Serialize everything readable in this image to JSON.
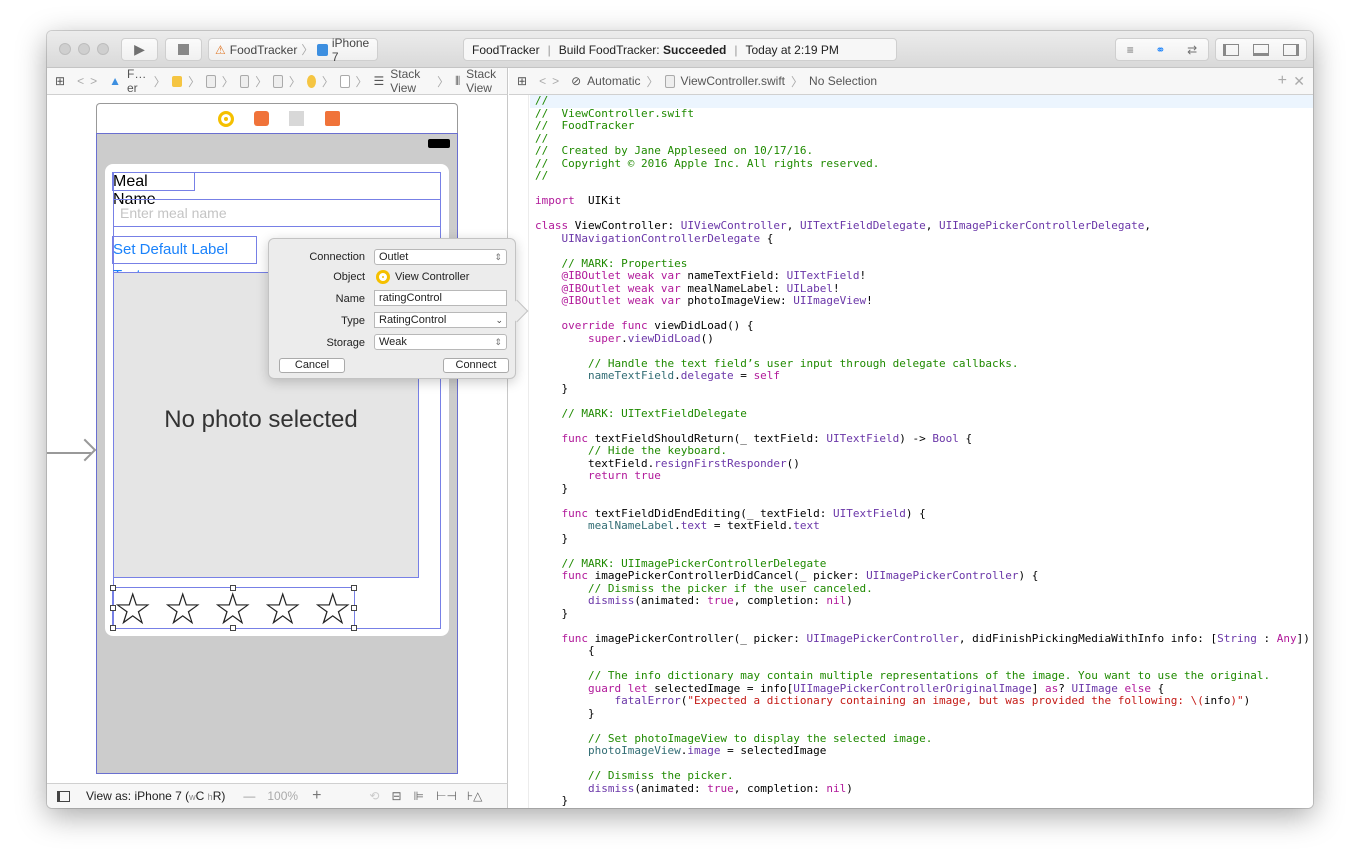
{
  "toolbar": {
    "scheme": "FoodTracker",
    "device": "iPhone 7",
    "activity": {
      "project": "FoodTracker",
      "build_prefix": "Build FoodTracker:",
      "build_status": "Succeeded",
      "time": "Today at 2:19 PM"
    }
  },
  "left_jumpbar": {
    "items": [
      "F…er",
      "Stack View",
      "Stack View"
    ]
  },
  "right_jumpbar": {
    "mode": "Automatic",
    "file": "ViewController.swift",
    "selection": "No Selection"
  },
  "canvas": {
    "meal_name_label": "Meal Name",
    "meal_name_placeholder": "Enter meal name",
    "set_default_button": "Set Default Label Text",
    "photo_placeholder": "No photo selected",
    "star_count": 5
  },
  "popover": {
    "connection_label": "Connection",
    "connection_value": "Outlet",
    "object_label": "Object",
    "object_value": "View Controller",
    "name_label": "Name",
    "name_value": "ratingControl",
    "type_label": "Type",
    "type_value": "RatingControl",
    "storage_label": "Storage",
    "storage_value": "Weak",
    "cancel": "Cancel",
    "connect": "Connect"
  },
  "bottom_bar": {
    "view_as": "View as: iPhone 7 (",
    "w": "w",
    "wc": "C ",
    "h": "h",
    "hr": "R)",
    "zoom": "100%"
  },
  "colors": {
    "selection": "#7780e6",
    "accent": "#1a82fb",
    "comment": "#1f8a00",
    "keyword": "#b1199a",
    "type": "#6a36a8",
    "project": "#326d74",
    "string": "#c41a16"
  },
  "code": [
    [
      [
        "c",
        "//"
      ]
    ],
    [
      [
        "c",
        "//  ViewController.swift"
      ]
    ],
    [
      [
        "c",
        "//  FoodTracker"
      ]
    ],
    [
      [
        "c",
        "//"
      ]
    ],
    [
      [
        "c",
        "//  Created by Jane Appleseed on 10/17/16."
      ]
    ],
    [
      [
        "c",
        "//  Copyright © 2016 Apple Inc. All rights reserved."
      ]
    ],
    [
      [
        "c",
        "//"
      ]
    ],
    [],
    [
      [
        "k",
        "import"
      ],
      [
        "",
        "  UIKit"
      ]
    ],
    [],
    [
      [
        "k",
        "class"
      ],
      [
        "",
        " ViewController: "
      ],
      [
        "t",
        "UIViewController"
      ],
      [
        "",
        ", "
      ],
      [
        "t",
        "UITextFieldDelegate"
      ],
      [
        "",
        ", "
      ],
      [
        "t",
        "UIImagePickerControllerDelegate"
      ],
      [
        "",
        ","
      ]
    ],
    [
      [
        "",
        "    "
      ],
      [
        "t",
        "UINavigationControllerDelegate"
      ],
      [
        "",
        " {"
      ]
    ],
    [],
    [
      [
        "c",
        "    // MARK: Properties"
      ]
    ],
    [
      [
        "k",
        "    @IBOutlet weak var"
      ],
      [
        "",
        " nameTextField: "
      ],
      [
        "t",
        "UITextField"
      ],
      [
        "",
        "!"
      ]
    ],
    [
      [
        "k",
        "    @IBOutlet weak var"
      ],
      [
        "",
        " mealNameLabel: "
      ],
      [
        "t",
        "UILabel"
      ],
      [
        "",
        "!"
      ]
    ],
    [
      [
        "k",
        "    @IBOutlet weak var"
      ],
      [
        "",
        " photoImageView: "
      ],
      [
        "t",
        "UIImageView"
      ],
      [
        "",
        "!"
      ]
    ],
    [],
    [
      [
        "k",
        "    override func"
      ],
      [
        "",
        " viewDidLoad() {"
      ]
    ],
    [
      [
        "k",
        "        super"
      ],
      [
        "",
        "."
      ],
      [
        "t",
        "viewDidLoad"
      ],
      [
        "",
        "()"
      ]
    ],
    [],
    [
      [
        "c",
        "        // Handle the text field’s user input through delegate callbacks."
      ]
    ],
    [
      [
        "p",
        "        nameTextField"
      ],
      [
        "",
        "."
      ],
      [
        "t",
        "delegate"
      ],
      [
        "",
        " = "
      ],
      [
        "k",
        "self"
      ]
    ],
    [
      [
        "",
        "    }"
      ]
    ],
    [],
    [
      [
        "c",
        "    // MARK: UITextFieldDelegate"
      ]
    ],
    [],
    [
      [
        "k",
        "    func"
      ],
      [
        "",
        " textFieldShouldReturn(_ textField: "
      ],
      [
        "t",
        "UITextField"
      ],
      [
        "",
        ") -> "
      ],
      [
        "t",
        "Bool"
      ],
      [
        "",
        " {"
      ]
    ],
    [
      [
        "c",
        "        // Hide the keyboard."
      ]
    ],
    [
      [
        "",
        "        textField."
      ],
      [
        "t",
        "resignFirstResponder"
      ],
      [
        "",
        "()"
      ]
    ],
    [
      [
        "k",
        "        return true"
      ]
    ],
    [
      [
        "",
        "    }"
      ]
    ],
    [],
    [
      [
        "k",
        "    func"
      ],
      [
        "",
        " textFieldDidEndEditing(_ textField: "
      ],
      [
        "t",
        "UITextField"
      ],
      [
        "",
        ") {"
      ]
    ],
    [
      [
        "p",
        "        mealNameLabel"
      ],
      [
        "",
        "."
      ],
      [
        "t",
        "text"
      ],
      [
        "",
        " = textField."
      ],
      [
        "t",
        "text"
      ]
    ],
    [
      [
        "",
        "    }"
      ]
    ],
    [],
    [
      [
        "c",
        "    // MARK: UIImagePickerControllerDelegate"
      ]
    ],
    [
      [
        "k",
        "    func"
      ],
      [
        "",
        " imagePickerControllerDidCancel(_ picker: "
      ],
      [
        "t",
        "UIImagePickerController"
      ],
      [
        "",
        ") {"
      ]
    ],
    [
      [
        "c",
        "        // Dismiss the picker if the user canceled."
      ]
    ],
    [
      [
        "t",
        "        dismiss"
      ],
      [
        "",
        "(animated: "
      ],
      [
        "k",
        "true"
      ],
      [
        "",
        ", completion: "
      ],
      [
        "k",
        "nil"
      ],
      [
        "",
        ")"
      ]
    ],
    [
      [
        "",
        "    }"
      ]
    ],
    [],
    [
      [
        "k",
        "    func"
      ],
      [
        "",
        " imagePickerController(_ picker: "
      ],
      [
        "t",
        "UIImagePickerController"
      ],
      [
        "",
        ", didFinishPickingMediaWithInfo info: ["
      ],
      [
        "t",
        "String"
      ],
      [
        "",
        " : "
      ],
      [
        "k",
        "Any"
      ],
      [
        "",
        "])"
      ]
    ],
    [
      [
        "",
        "        {"
      ]
    ],
    [],
    [
      [
        "c",
        "        // The info dictionary may contain multiple representations of the image. You want to use the original."
      ]
    ],
    [
      [
        "k",
        "        guard let"
      ],
      [
        "",
        " selectedImage = info["
      ],
      [
        "t",
        "UIImagePickerControllerOriginalImage"
      ],
      [
        "",
        "] "
      ],
      [
        "k",
        "as"
      ],
      [
        "",
        "? "
      ],
      [
        "t",
        "UIImage"
      ],
      [
        "",
        " "
      ],
      [
        "k",
        "else"
      ],
      [
        "",
        " {"
      ]
    ],
    [
      [
        "t",
        "            fatalError"
      ],
      [
        "",
        "("
      ],
      [
        "s",
        "\"Expected a dictionary containing an image, but was provided the following: \\("
      ],
      [
        "",
        "info"
      ],
      [
        "s",
        ")\""
      ],
      [
        "",
        ")"
      ]
    ],
    [
      [
        "",
        "        }"
      ]
    ],
    [],
    [
      [
        "c",
        "        // Set photoImageView to display the selected image."
      ]
    ],
    [
      [
        "p",
        "        photoImageView"
      ],
      [
        "",
        "."
      ],
      [
        "t",
        "image"
      ],
      [
        "",
        " = selectedImage"
      ]
    ],
    [],
    [
      [
        "c",
        "        // Dismiss the picker."
      ]
    ],
    [
      [
        "t",
        "        dismiss"
      ],
      [
        "",
        "(animated: "
      ],
      [
        "k",
        "true"
      ],
      [
        "",
        ", completion: "
      ],
      [
        "k",
        "nil"
      ],
      [
        "",
        ")"
      ]
    ],
    [
      [
        "",
        "    }"
      ]
    ]
  ]
}
